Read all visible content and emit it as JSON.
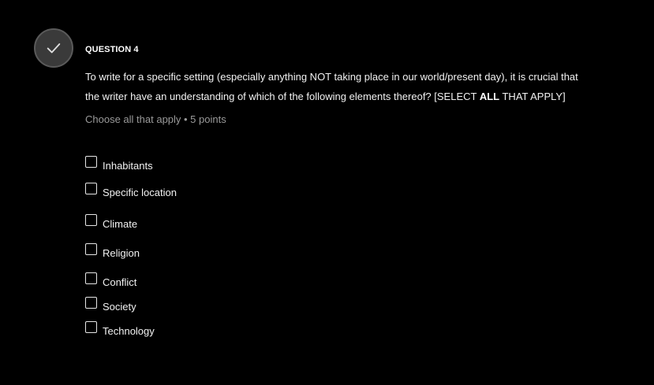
{
  "question": {
    "number_label": "QUESTION 4",
    "prompt_part1": "To write for a specific setting (especially anything NOT taking place in our world/present day), it is crucial that the writer have an understanding of which of the following elements thereof? [SELECT ",
    "prompt_bold": "ALL",
    "prompt_part2": " THAT APPLY]",
    "meta": "Choose all that apply • 5 points",
    "status_icon": "check-icon"
  },
  "options": [
    {
      "label": "Inhabitants",
      "checked": false
    },
    {
      "label": "Specific location",
      "checked": false
    },
    {
      "label": "Climate",
      "checked": false
    },
    {
      "label": "Religion",
      "checked": false
    },
    {
      "label": "Conflict",
      "checked": false
    },
    {
      "label": "Society",
      "checked": false
    },
    {
      "label": "Technology",
      "checked": false
    }
  ],
  "colors": {
    "background": "#000000",
    "text": "#f2f2f2",
    "muted": "#9a9a9a",
    "status_circle": "#3a3a3a"
  }
}
